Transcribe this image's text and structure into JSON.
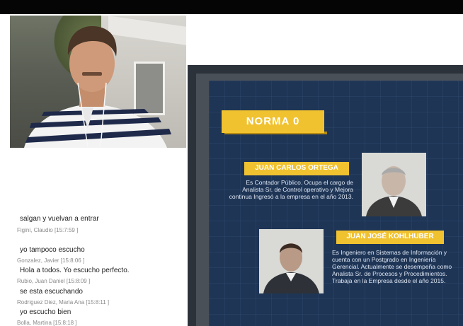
{
  "chat": {
    "messages": [
      {
        "text": "salgan y vuelvan a entrar",
        "author": "Figini, Claudio",
        "time": "[15:7:59 ]"
      },
      {
        "text": "yo tampoco escucho",
        "author": "Gonzalez, Javier",
        "time": "[15:8:06 ]"
      },
      {
        "text": "Hola a todos. Yo escucho perfecto.",
        "author": "Rubio, Juan Daniel",
        "time": "[15:8:09 ]"
      },
      {
        "text": "se esta escuchando",
        "author": "Rodriguez Diez, Maria Ana",
        "time": "[15:8:11 ]"
      },
      {
        "text": "yo escucho bien",
        "author": "Bolla, Martina",
        "time": "[15:8:18 ]"
      }
    ]
  },
  "slide": {
    "title": "NORMA 0",
    "speaker1": {
      "name": "JUAN CARLOS ORTEGA",
      "description": "Es Contador Público. Ocupa el cargo de Analista Sr. de Control operativo y Mejora continua Ingresó a la empresa en el año 2013."
    },
    "speaker2": {
      "name": "JUAN JOSÉ KOHLHUBER",
      "description": "Es Ingeniero en Sistemas de Información y cuenta con un Postgrado en Ingeniería Gerencial. Actualmente se desempeña como Analista Sr. de Procesos y Procedimientos. Trabaja en la Empresa desde el año 2015."
    }
  },
  "colors": {
    "accent": "#f1c230",
    "slide_bg": "#1e3556",
    "frame": "#2c323a"
  }
}
